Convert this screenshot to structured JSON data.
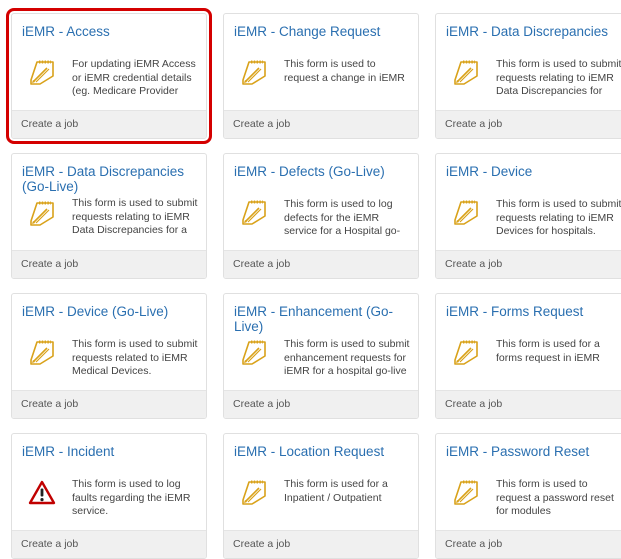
{
  "cards": [
    {
      "title": "iEMR - Access",
      "desc": "For updating iEMR Access or iEMR credential details (eg. Medicare Provider Number.",
      "footer": "Create a job",
      "icon": "form-edit-icon",
      "selected": true
    },
    {
      "title": "iEMR - Change Request",
      "desc": "This form is used to request a change in iEMR",
      "footer": "Create a job",
      "icon": "form-edit-icon"
    },
    {
      "title": "iEMR - Data Discrepancies",
      "desc": "This form is used to submit requests relating to iEMR Data Discrepancies for hospitals.",
      "footer": "Create a job",
      "icon": "form-edit-icon"
    },
    {
      "title": "iEMR - Data Discrepancies (Go-Live)",
      "desc": "This form is used to submit requests relating to iEMR Data Discrepancies for a hospital",
      "footer": "Create a job",
      "icon": "form-edit-icon"
    },
    {
      "title": "iEMR - Defects (Go-Live)",
      "desc": "This form is used to log defects for the iEMR service for a Hospital go-live period.",
      "footer": "Create a job",
      "icon": "form-edit-icon"
    },
    {
      "title": "iEMR - Device",
      "desc": "This form is used to submit requests relating to iEMR Devices for hospitals.",
      "footer": "Create a job",
      "icon": "form-edit-icon"
    },
    {
      "title": "iEMR - Device (Go-Live)",
      "desc": "This form is used to submit requests related to iEMR Medical Devices.",
      "footer": "Create a job",
      "icon": "form-edit-icon"
    },
    {
      "title": "iEMR - Enhancement (Go-Live)",
      "desc": "This form is used to submit enhancement requests for iEMR for a hospital go-live",
      "footer": "Create a job",
      "icon": "form-edit-icon"
    },
    {
      "title": "iEMR - Forms Request",
      "desc": "This form is used for a forms request in iEMR",
      "footer": "Create a job",
      "icon": "form-edit-icon"
    },
    {
      "title": "iEMR - Incident",
      "desc": "This form is used to log faults regarding the iEMR service.",
      "footer": "Create a job",
      "icon": "warning-icon"
    },
    {
      "title": "iEMR - Location Request",
      "desc": "This form is used for a Inpatient / Outpatient",
      "footer": "Create a job",
      "icon": "form-edit-icon"
    },
    {
      "title": "iEMR - Password Reset",
      "desc": "This form is used to request a password reset for modules",
      "footer": "Create a job",
      "icon": "form-edit-icon"
    }
  ],
  "colors": {
    "title": "#2a6fb0",
    "icon_gold": "#d9a21a",
    "selection": "#d40000",
    "warning": "#c00000"
  }
}
